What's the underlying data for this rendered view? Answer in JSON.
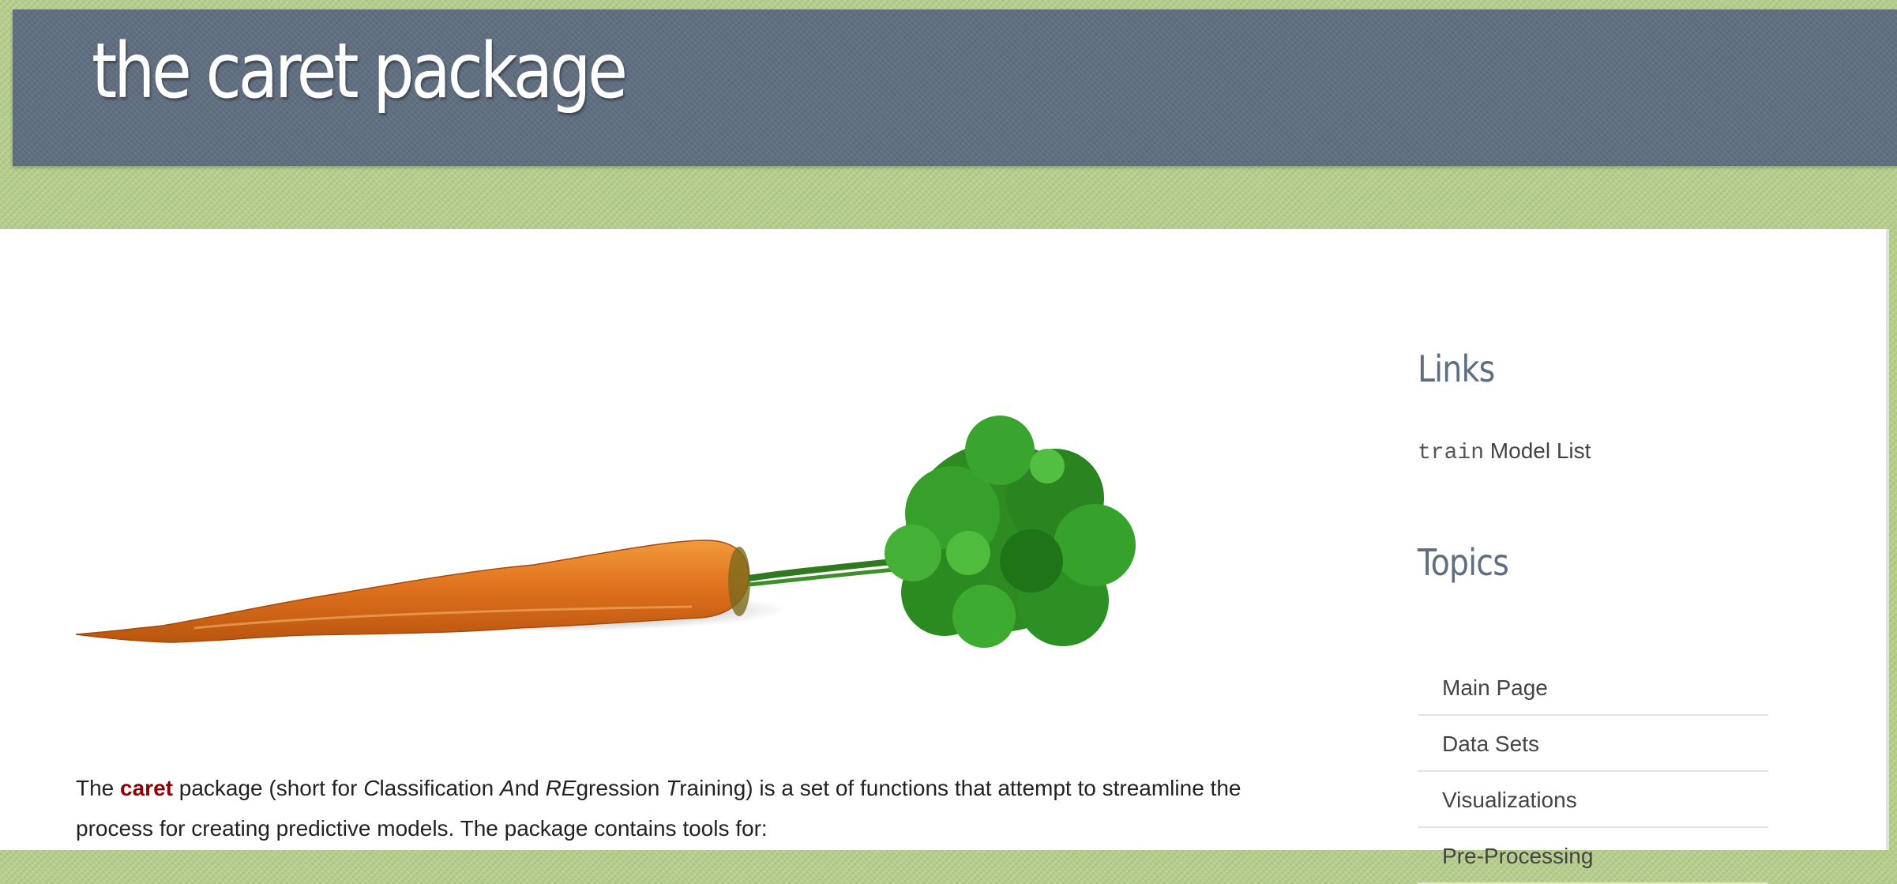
{
  "header": {
    "title": "the caret package"
  },
  "intro": {
    "the": "The",
    "package_name": "caret",
    "t1": "package (short for",
    "c": "C",
    "t2": "lassification",
    "a": "A",
    "t3": "nd",
    "re": "RE",
    "t4": "gression",
    "tr": "T",
    "t5": "raining) is a set of functions that attempt to streamline the process for creating predictive models. The package contains tools for:"
  },
  "sidebar": {
    "links_heading": "Links",
    "model_list_code": "train",
    "model_list_label": "Model List",
    "topics_heading": "Topics",
    "topics": [
      "Main Page",
      "Data Sets",
      "Visualizations",
      "Pre-Processing"
    ]
  },
  "colors": {
    "header_bg": "#5f6e80",
    "page_bg": "#b5cd8b",
    "package_name": "#8b0000",
    "heading": "#5f6e80"
  },
  "image": {
    "name": "carrot-illustration"
  }
}
